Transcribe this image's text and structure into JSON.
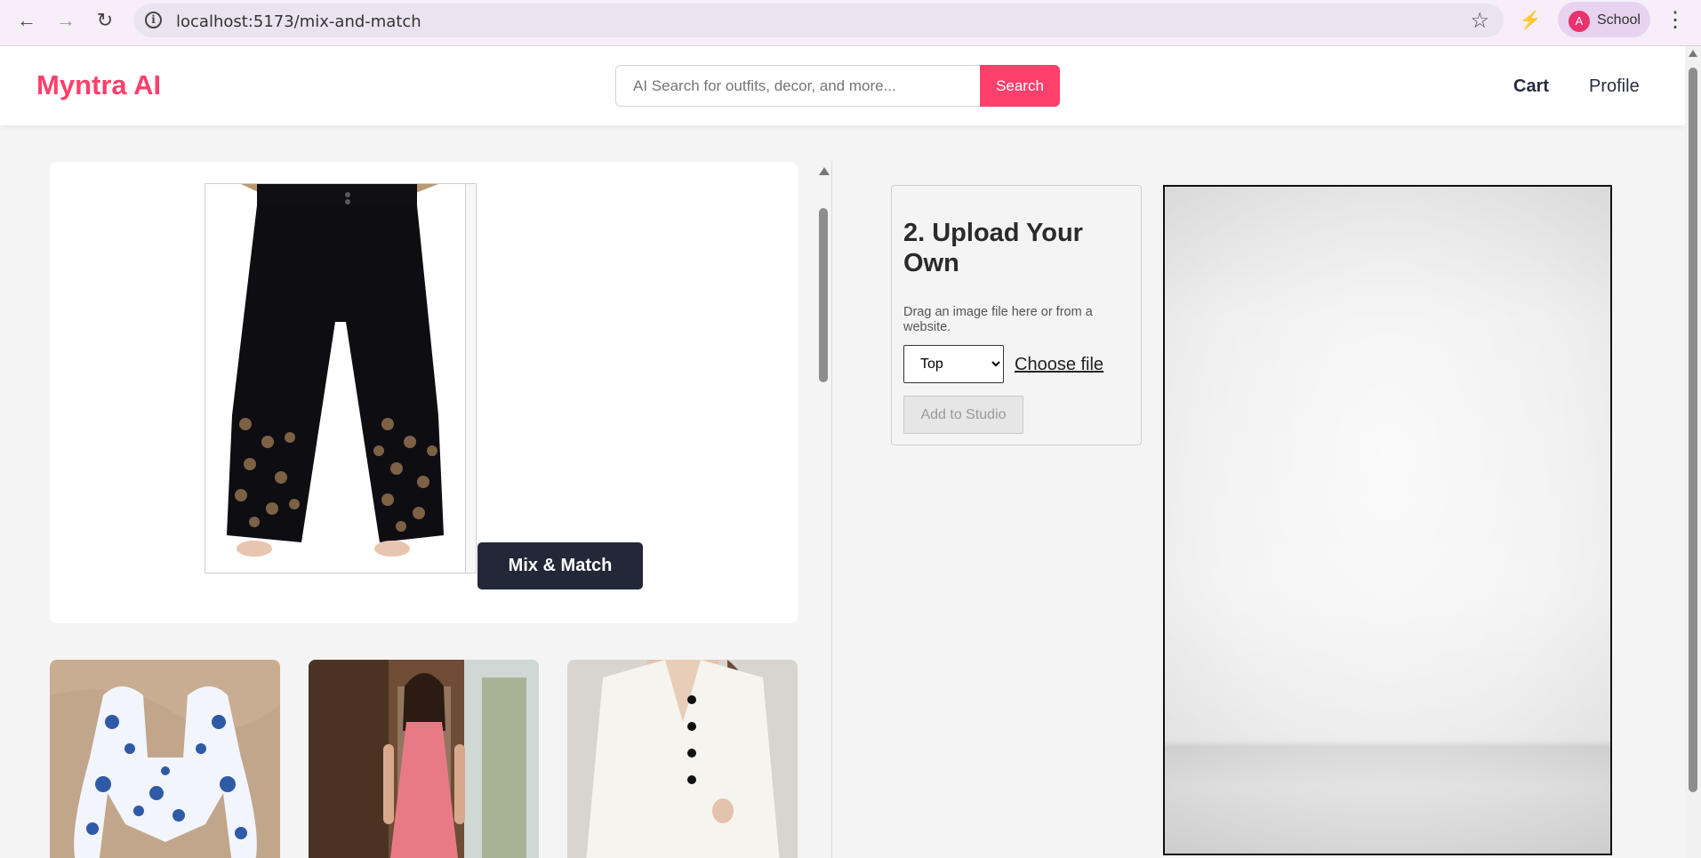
{
  "browser": {
    "url": "localhost:5173/mix-and-match",
    "profile_initial": "A",
    "profile_name": "School",
    "back_icon": "←",
    "forward_icon": "→",
    "reload_icon": "↻",
    "info_icon": "i",
    "star_icon": "☆",
    "extension_icon": "⚡",
    "menu_icon": "⋮"
  },
  "header": {
    "brand": "Myntra AI",
    "search_placeholder": "AI Search for outfits, decor, and more...",
    "search_button": "Search",
    "nav": [
      "Cart",
      "Profile"
    ]
  },
  "mix_panel": {
    "selected_item_icon": "pants-image",
    "mix_button": "Mix & Match"
  },
  "product_cards": [
    {
      "image": "floral-top-image"
    },
    {
      "image": "pink-dress-image"
    },
    {
      "image": "white-dress-image"
    }
  ],
  "upload": {
    "title": "2. Upload Your Own",
    "description": "Drag an image file here or from a website.",
    "type_options": [
      "Top"
    ],
    "selected_type": "Top",
    "choose_file": "Choose file",
    "add_button": "Add to Studio"
  },
  "colors": {
    "accent": "#ff3f6c",
    "dark_button": "#232838"
  }
}
